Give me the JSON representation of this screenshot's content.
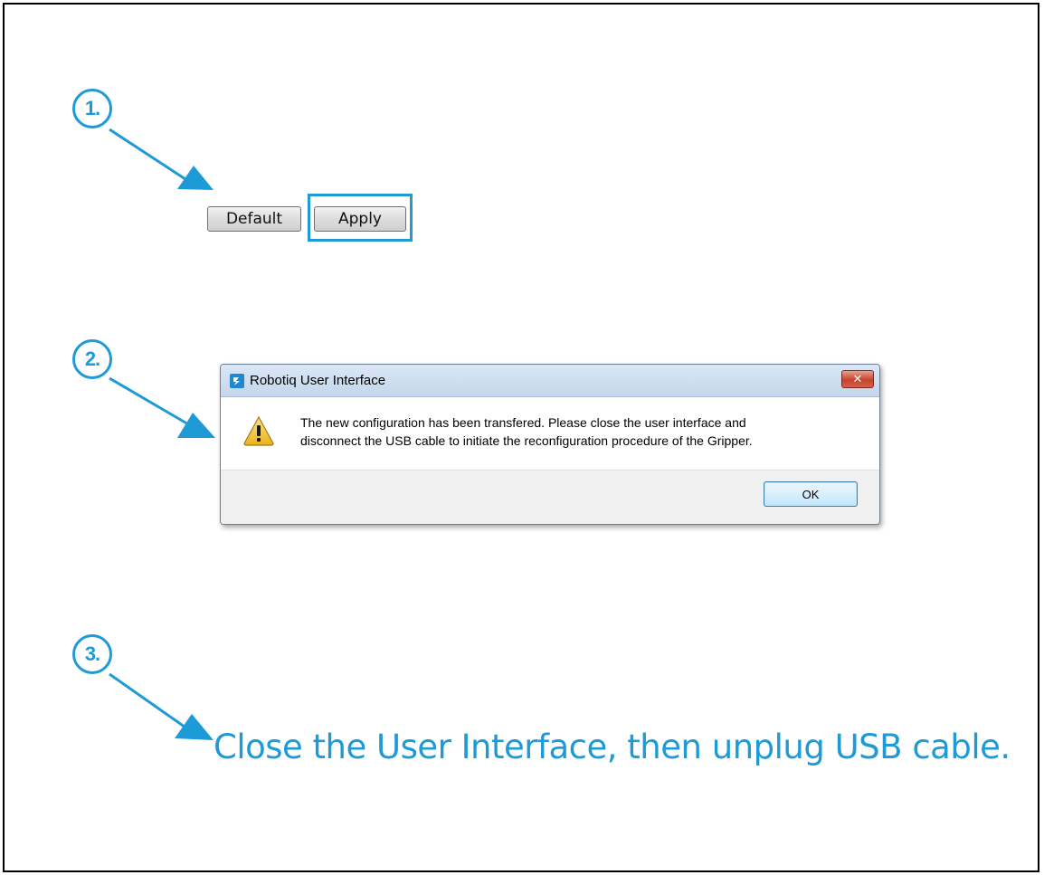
{
  "steps": {
    "one": "1.",
    "two": "2.",
    "three": "3."
  },
  "buttons": {
    "default_label": "Default",
    "apply_label": "Apply"
  },
  "dialog": {
    "title": "Robotiq User Interface",
    "close_glyph": "✕",
    "message_line1": "The new configuration has been transfered. Please close the user interface and",
    "message_line2": "disconnect the USB cable to initiate the reconfiguration procedure of the Gripper.",
    "ok_label": "OK",
    "icons": {
      "app": "robotiq-app-icon",
      "warning": "warning-icon",
      "close": "close-icon"
    }
  },
  "instruction": "Close the User Interface, then unplug USB cable.",
  "colors": {
    "accent": "#1e9bd7",
    "close_red": "#c7432c",
    "warning_yellow": "#f4c430"
  }
}
